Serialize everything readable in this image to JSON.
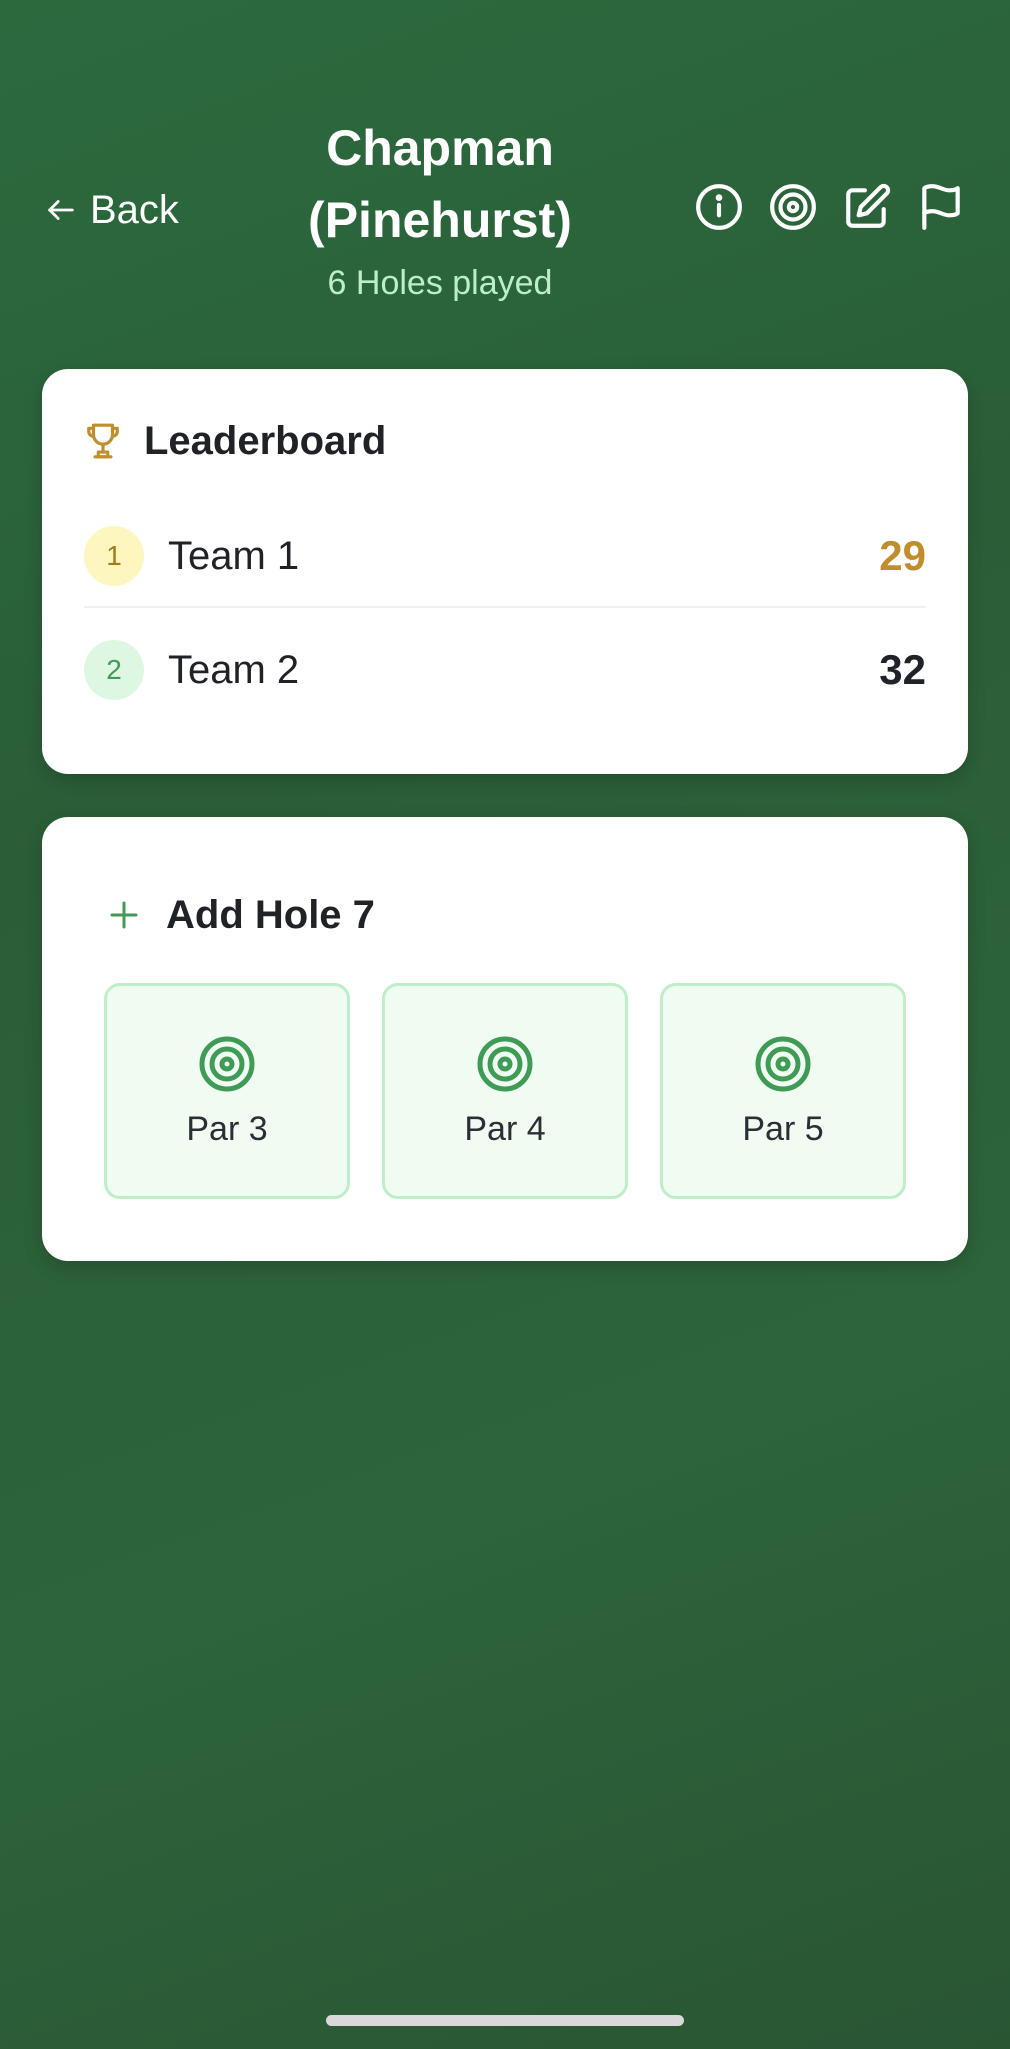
{
  "header": {
    "back_label": "Back",
    "title_line1": "Chapman",
    "title_line2": "(Pinehurst)",
    "subtitle": "6 Holes played",
    "icons": [
      "info-icon",
      "target-icon",
      "edit-icon",
      "flag-icon"
    ]
  },
  "leaderboard": {
    "title": "Leaderboard",
    "icon": "trophy-icon",
    "rows": [
      {
        "rank": "1",
        "team": "Team 1",
        "score": "29",
        "highlight": "#c08f2c"
      },
      {
        "rank": "2",
        "team": "Team 2",
        "score": "32",
        "highlight": "#1f2328"
      }
    ]
  },
  "add_hole": {
    "title": "Add Hole 7",
    "icon": "plus-icon",
    "options": [
      {
        "label": "Par 3",
        "icon": "target-icon"
      },
      {
        "label": "Par 4",
        "icon": "target-icon"
      },
      {
        "label": "Par 5",
        "icon": "target-icon"
      }
    ]
  },
  "colors": {
    "background": "#2a5e37",
    "accent_green": "#3f9b56",
    "gold": "#c08f2c",
    "subtitle": "#bdeec6"
  }
}
